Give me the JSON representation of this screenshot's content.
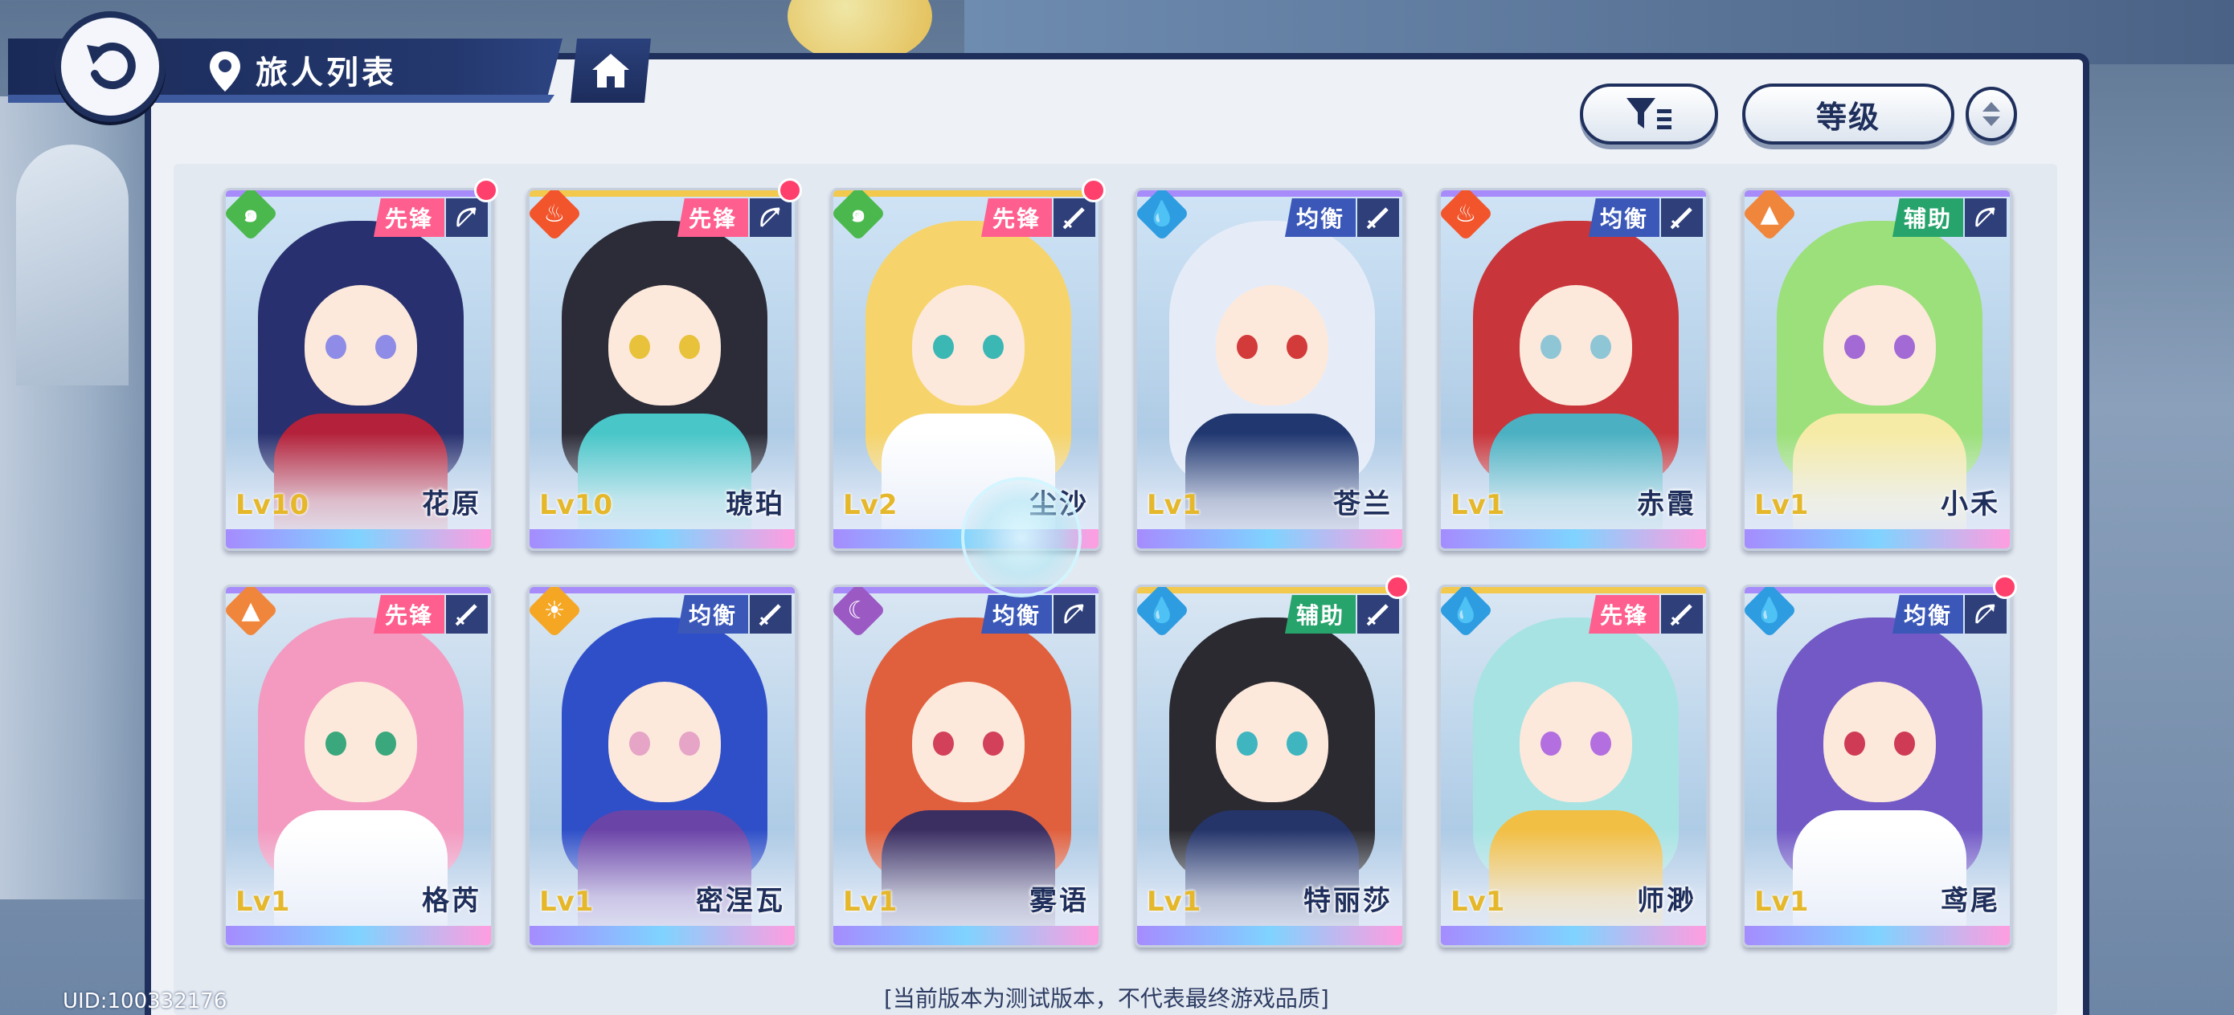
{
  "header": {
    "title": "旅人列表"
  },
  "controls": {
    "sort_label": "等级"
  },
  "characters": [
    {
      "name": "花原",
      "level": "Lv10",
      "role": "先锋",
      "element": "wind",
      "weapon": "bow",
      "new": true,
      "accent": "#ff5f8f",
      "hair": "#28306f",
      "outfit": "#b3213a",
      "eye": "#8e8ce6",
      "rarity_color": "#a78bfa"
    },
    {
      "name": "琥珀",
      "level": "Lv10",
      "role": "先锋",
      "element": "fire",
      "weapon": "bow",
      "new": true,
      "accent": "#ff5f8f",
      "hair": "#2b2c38",
      "outfit": "#48c6c8",
      "eye": "#e8c23a",
      "rarity_color": "#f2c94c"
    },
    {
      "name": "尘沙",
      "level": "Lv2",
      "role": "先锋",
      "element": "wind",
      "weapon": "sword",
      "new": true,
      "accent": "#ff5f8f",
      "hair": "#f6d46b",
      "outfit": "#ffffff",
      "eye": "#3bb7b4",
      "rarity_color": "#f2c94c"
    },
    {
      "name": "苍兰",
      "level": "Lv1",
      "role": "均衡",
      "element": "water",
      "weapon": "sword",
      "new": false,
      "accent": "#3b58b8",
      "hair": "#e5ecf7",
      "outfit": "#203770",
      "eye": "#d33a3a",
      "rarity_color": "#a78bfa"
    },
    {
      "name": "赤霞",
      "level": "Lv1",
      "role": "均衡",
      "element": "fire",
      "weapon": "sword",
      "new": false,
      "accent": "#3b58b8",
      "hair": "#c8353a",
      "outfit": "#4bb1c2",
      "eye": "#8fc6d6",
      "rarity_color": "#a78bfa"
    },
    {
      "name": "小禾",
      "level": "Lv1",
      "role": "辅助",
      "element": "earth",
      "weapon": "bow",
      "new": false,
      "accent": "#27a36c",
      "hair": "#9be07a",
      "outfit": "#f6eba6",
      "eye": "#a36ad6",
      "rarity_color": "#a78bfa"
    },
    {
      "name": "格芮",
      "level": "Lv1",
      "role": "先锋",
      "element": "earth",
      "weapon": "sword",
      "new": false,
      "accent": "#ff5f8f",
      "hair": "#f49ac0",
      "outfit": "#ffffff",
      "eye": "#3aa87c",
      "rarity_color": "#a78bfa"
    },
    {
      "name": "密涅瓦",
      "level": "Lv1",
      "role": "均衡",
      "element": "light",
      "weapon": "sword",
      "new": false,
      "accent": "#3b58b8",
      "hair": "#2f4fc8",
      "outfit": "#6b44a8",
      "eye": "#e6a4c6",
      "rarity_color": "#a78bfa"
    },
    {
      "name": "雾语",
      "level": "Lv1",
      "role": "均衡",
      "element": "dark",
      "weapon": "bow",
      "new": false,
      "accent": "#3b58b8",
      "hair": "#e0603e",
      "outfit": "#3b2f62",
      "eye": "#d3405a",
      "rarity_color": "#a78bfa"
    },
    {
      "name": "特丽莎",
      "level": "Lv1",
      "role": "辅助",
      "element": "water",
      "weapon": "sword",
      "new": true,
      "accent": "#27a36c",
      "hair": "#2a2a30",
      "outfit": "#25356a",
      "eye": "#3fb5c0",
      "rarity_color": "#f2c94c"
    },
    {
      "name": "师渺",
      "level": "Lv1",
      "role": "先锋",
      "element": "water",
      "weapon": "sword",
      "new": false,
      "accent": "#ff5f8f",
      "hair": "#a8e3e3",
      "outfit": "#f2bf45",
      "eye": "#b36ee0",
      "rarity_color": "#f2c94c"
    },
    {
      "name": "鸢尾",
      "level": "Lv1",
      "role": "均衡",
      "element": "water",
      "weapon": "bow",
      "new": true,
      "accent": "#3b58b8",
      "hair": "#7259c6",
      "outfit": "#ffffff",
      "eye": "#cf3b54",
      "rarity_color": "#a78bfa"
    }
  ],
  "element_colors": {
    "wind": "#4bb84e",
    "fire": "#f2552c",
    "water": "#2e9ce0",
    "earth": "#f0863c",
    "light": "#f5a623",
    "dark": "#9b59c4"
  },
  "element_glyphs": {
    "wind": "๑",
    "fire": "♨",
    "water": "💧",
    "earth": "▲",
    "light": "☀",
    "dark": "☾"
  },
  "footer": {
    "uid": "UID:100332176",
    "note": "[当前版本为测试版本，不代表最终游戏品质]"
  }
}
